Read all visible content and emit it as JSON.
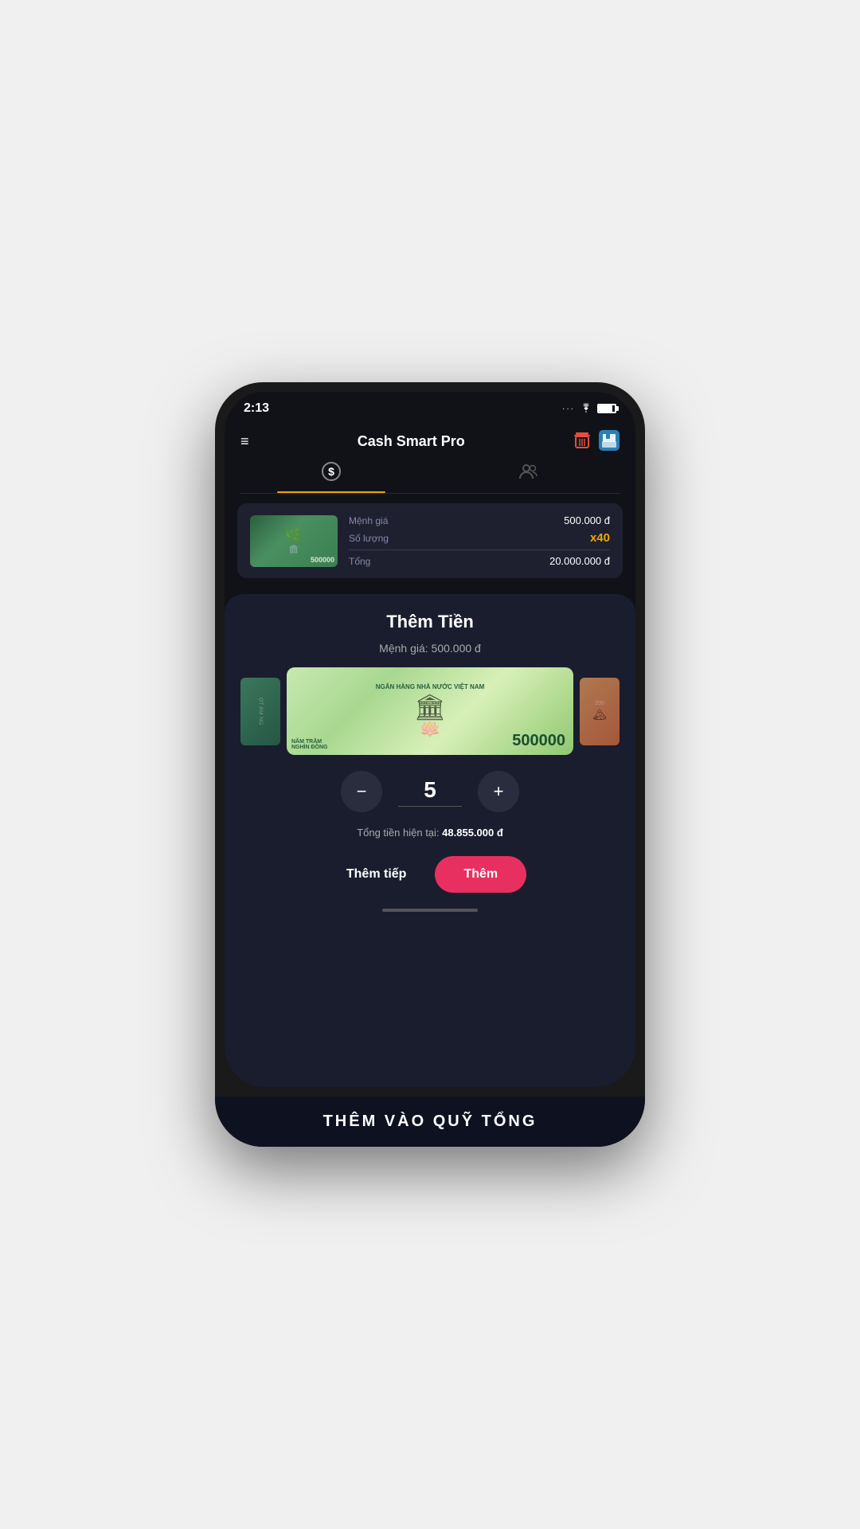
{
  "status": {
    "time": "2:13",
    "wifi": "wifi",
    "battery": "battery"
  },
  "header": {
    "title": "Cash Smart Pro",
    "menu_label": "≡",
    "trash_label": "delete",
    "save_label": "save"
  },
  "tabs": [
    {
      "id": "money",
      "icon": "💲",
      "active": true
    },
    {
      "id": "people",
      "icon": "👥",
      "active": false
    }
  ],
  "bill_card": {
    "menh_gia_label": "Mệnh giá",
    "menh_gia_value": "500.000 đ",
    "so_luong_label": "Số lượng",
    "so_luong_value": "x40",
    "tong_label": "Tổng",
    "tong_value": "20.000.000 đ"
  },
  "modal": {
    "title": "Thêm Tiền",
    "subtitle": "Mệnh giá: 500.000 đ",
    "stepper_value": "5",
    "total_label": "Tổng tiền hiện tại:",
    "total_value": "48.855.000 đ",
    "btn_them_tiep": "Thêm tiếp",
    "btn_them": "Thêm",
    "bill_main_header": "NGÂN HÀNG NHÀ NƯỚC VIỆT NAM",
    "bill_main_amount": "500000",
    "bill_main_text": "NĂM TRĂM\nNGHÌN ĐỒNG"
  },
  "bottom_banner": {
    "text": "THÊM VÀO QUỸ TỔNG"
  }
}
